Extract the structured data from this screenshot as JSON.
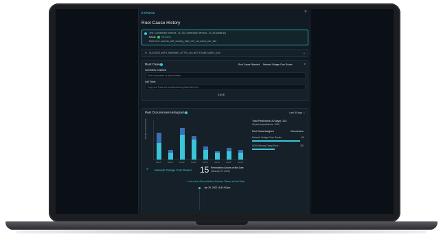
{
  "panel": {
    "expand_label": "EXPAND",
    "close_symbol": "×",
    "title": "Root Cause History"
  },
  "status": {
    "line1": "Test: Connectivity Services - SL-SA Connectivity Services - SL-SA ipaddr.ipq",
    "result_label": "Result:",
    "result_value": "Resolved",
    "line3": "Root Error: success_with_warning_https_401_not_found_user_ldm"
  },
  "collapsed_row": {
    "label": "SUCCESS_WITH_WARNING_HTTPS_401-NOT-FOUND-USER_LDM"
  },
  "root_cause": {
    "label": "Root Cause",
    "selected_label": "Root Cause Selected:",
    "selected_value": "Network Outage Core Router",
    "comments_label": "Comments or actions",
    "comments_placeholder": "Enter comments or actions taken",
    "ticket_label": "Add Ticket",
    "ticket_placeholder": "Copy and Paste the troubleshooting ticket link here",
    "save_label": "SAVE"
  },
  "histogram": {
    "title": "Past Occurrences Histogram",
    "range": "Last 30 days",
    "summary_total": "Total Predictions (30 days): 124",
    "summary_all": "All period predictions: 1290",
    "col_cause": "Root Cause Assigned",
    "col_occ": "Occurrences",
    "rows": [
      {
        "cause": "Network Outage Core Router",
        "count": "89",
        "fraction": 0.85
      },
      {
        "cause": "UDM Memory Dump Error...",
        "count": "3/5",
        "fraction": 0.4
      }
    ],
    "remediation_cause": "Network Outage Core Router",
    "remediation_count": "15",
    "remediation_label": "Remediation Actions at this Date",
    "remediation_date": "(January 29, 2022)",
    "list_title": "List of the Remediation Actions Taken at this Date",
    "entry_date": "Jan 29, 2022 16:41:08 pm"
  },
  "chart_data": {
    "type": "bar",
    "categories": [
      "09/23",
      "09/28",
      "10/03",
      "10/08",
      "10/13",
      "10/18",
      "10/23",
      "10/28"
    ],
    "series": [
      {
        "values": [
          10,
          4,
          15,
          12,
          6,
          4,
          5,
          4
        ]
      },
      {
        "values": [
          6,
          2,
          4,
          2,
          2,
          1,
          2,
          2
        ]
      }
    ],
    "ylim": [
      0,
      24
    ],
    "ylabel": "Number of Occurrences"
  },
  "colors": {
    "accent": "#3ac5d8",
    "bar_light": "#3ac5d8",
    "bar_dark": "#3a6fb5"
  }
}
